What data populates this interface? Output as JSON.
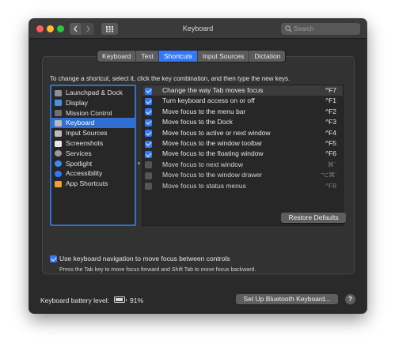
{
  "window": {
    "title": "Keyboard"
  },
  "search": {
    "placeholder": "Search"
  },
  "tabs": [
    {
      "label": "Keyboard",
      "active": false
    },
    {
      "label": "Text",
      "active": false
    },
    {
      "label": "Shortcuts",
      "active": true
    },
    {
      "label": "Input Sources",
      "active": false
    },
    {
      "label": "Dictation",
      "active": false
    }
  ],
  "instructions": "To change a shortcut, select it, click the key combination, and then type the new keys.",
  "categories": [
    {
      "label": "Launchpad & Dock",
      "icon": "launchpad-dock-icon",
      "color": "#8e8e93",
      "selected": false
    },
    {
      "label": "Display",
      "icon": "display-icon",
      "color": "#4a90e2",
      "selected": false
    },
    {
      "label": "Mission Control",
      "icon": "mission-control-icon",
      "color": "#6f6f74",
      "selected": false
    },
    {
      "label": "Keyboard",
      "icon": "keyboard-icon",
      "color": "#b9b9be",
      "selected": true
    },
    {
      "label": "Input Sources",
      "icon": "input-sources-icon",
      "color": "#b9b9be",
      "selected": false
    },
    {
      "label": "Screenshots",
      "icon": "screenshots-icon",
      "color": "#e8e8e8",
      "selected": false
    },
    {
      "label": "Services",
      "icon": "services-gear-icon",
      "color": "#9a9aa0",
      "selected": false
    },
    {
      "label": "Spotlight",
      "icon": "spotlight-icon",
      "color": "#3b8df0",
      "selected": false
    },
    {
      "label": "Accessibility",
      "icon": "accessibility-icon",
      "color": "#2f7cf0",
      "selected": false
    },
    {
      "label": "App Shortcuts",
      "icon": "app-shortcuts-icon",
      "color": "#f0a030",
      "selected": false
    }
  ],
  "shortcuts": [
    {
      "label": "Change the way Tab moves focus",
      "key": "^F7",
      "checked": true
    },
    {
      "label": "Turn keyboard access on or off",
      "key": "^F1",
      "checked": true
    },
    {
      "label": "Move focus to the menu bar",
      "key": "^F2",
      "checked": true
    },
    {
      "label": "Move focus to the Dock",
      "key": "^F3",
      "checked": true
    },
    {
      "label": "Move focus to active or next window",
      "key": "^F4",
      "checked": true
    },
    {
      "label": "Move focus to the window toolbar",
      "key": "^F5",
      "checked": true
    },
    {
      "label": "Move focus to the floating window",
      "key": "^F6",
      "checked": true
    },
    {
      "label": "Move focus to next window",
      "key": "⌘`",
      "checked": false
    },
    {
      "label": "Move focus to the window drawer",
      "key": "⌥⌘'",
      "checked": false
    },
    {
      "label": "Move focus to status menus",
      "key": "^F8",
      "checked": false
    }
  ],
  "buttons": {
    "restore_defaults": "Restore Defaults",
    "setup_bluetooth": "Set Up Bluetooth Keyboard...",
    "help": "?"
  },
  "keyboard_navigation": {
    "checked": true,
    "label": "Use keyboard navigation to move focus between controls",
    "hint": "Press the Tab key to move focus forward and Shift Tab to move focus backward."
  },
  "battery": {
    "label": "Keyboard battery level:",
    "value": "91%",
    "level": 0.91
  },
  "colors": {
    "accent": "#3478f6",
    "window_bg": "#2a2a2a",
    "selection": "#2f6ed3"
  }
}
